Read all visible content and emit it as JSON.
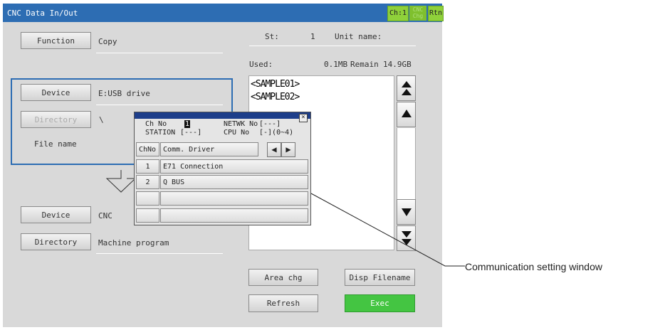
{
  "window": {
    "title": "CNC Data In/Out",
    "ch_label": "Ch:1",
    "cnc_chg_label": "CNC Chg",
    "rtn_label": "Rtn"
  },
  "function": {
    "button": "Function",
    "value": "Copy"
  },
  "status": {
    "st_label": "St:",
    "st_value": "1",
    "unit_name_label": "Unit name:",
    "used_label": "Used:",
    "used_value": "0.1MB",
    "remain_label": "Remain",
    "remain_value": "14.9GB"
  },
  "source": {
    "device_button": "Device",
    "device_value": "E:USB drive",
    "directory_button": "Directory",
    "directory_value": "\\",
    "file_name_label": "File name"
  },
  "destination": {
    "device_button": "Device",
    "device_value": "CNC",
    "directory_button": "Directory",
    "directory_value": "Machine program"
  },
  "file_list": [
    "<SAMPLE01>",
    "<SAMPLE02>"
  ],
  "comm_window": {
    "ch_no_label": "Ch No",
    "ch_no_value": "1",
    "netwk_no_label": "NETWK No",
    "netwk_no_value": "[---]",
    "station_label": "STATION",
    "station_value": "[---]",
    "cpu_no_label": "CPU No",
    "cpu_no_value": "[-](0~4)",
    "close_glyph": "×",
    "header_chno": "ChNo",
    "header_driver": "Comm. Driver",
    "rows": [
      {
        "no": "1",
        "driver": "E71 Connection"
      },
      {
        "no": "2",
        "driver": "Q BUS"
      },
      {
        "no": "",
        "driver": ""
      },
      {
        "no": "",
        "driver": ""
      }
    ]
  },
  "buttons": {
    "area_chg": "Area chg",
    "disp_filename": "Disp Filename",
    "refresh": "Refresh",
    "exec": "Exec"
  },
  "callout": {
    "label": "Communication setting window"
  },
  "icons": {
    "scroll_top": "double-up-arrow-icon",
    "scroll_up": "up-arrow-icon",
    "scroll_down": "down-arrow-icon",
    "scroll_bottom": "double-down-arrow-icon",
    "copy_direction": "down-arrow-outline-icon"
  },
  "colors": {
    "title_bar": "#2d6db3",
    "accent_green": "#44c542",
    "panel_bg": "#d9d9d9"
  }
}
